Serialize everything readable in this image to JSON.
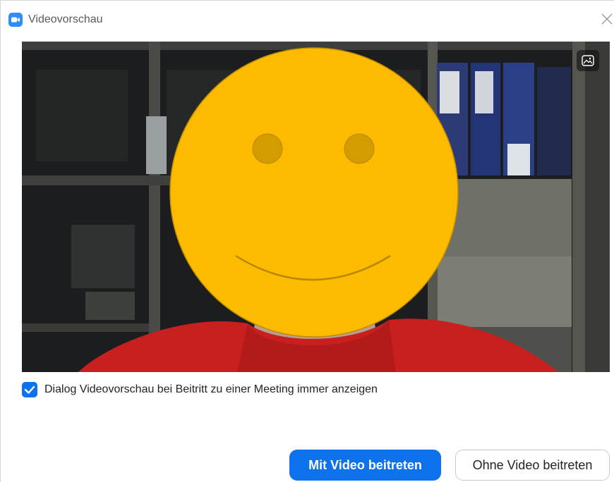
{
  "window": {
    "title": "Videovorschau",
    "app_icon": "video-camera-icon",
    "close_icon": "close-icon"
  },
  "preview": {
    "background_toggle_icon": "image-icon",
    "face_overlay": "smiley-face"
  },
  "options": {
    "always_show_label": "Dialog Videovorschau bei Beitritt zu einer Meeting immer anzeigen",
    "always_show_checked": true
  },
  "actions": {
    "join_with_video": "Mit Video beitreten",
    "join_without_video": "Ohne Video beitreten"
  },
  "colors": {
    "accent": "#0e72ed",
    "smiley": "#fdbb00",
    "sweater": "#c8201f"
  }
}
